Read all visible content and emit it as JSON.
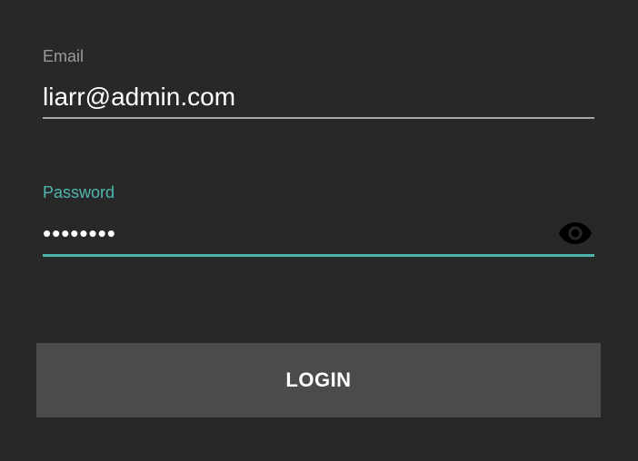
{
  "form": {
    "email": {
      "label": "Email",
      "value": "liarr@admin.com"
    },
    "password": {
      "label": "Password",
      "masked_value": "••••••••",
      "toggle_icon": "eye-icon"
    },
    "login_button": {
      "label": "LOGIN"
    }
  },
  "colors": {
    "background": "#282828",
    "accent": "#4fb6ae",
    "button": "#4b4b4b",
    "text": "#ffffff",
    "label_muted": "#9a9a9a"
  }
}
